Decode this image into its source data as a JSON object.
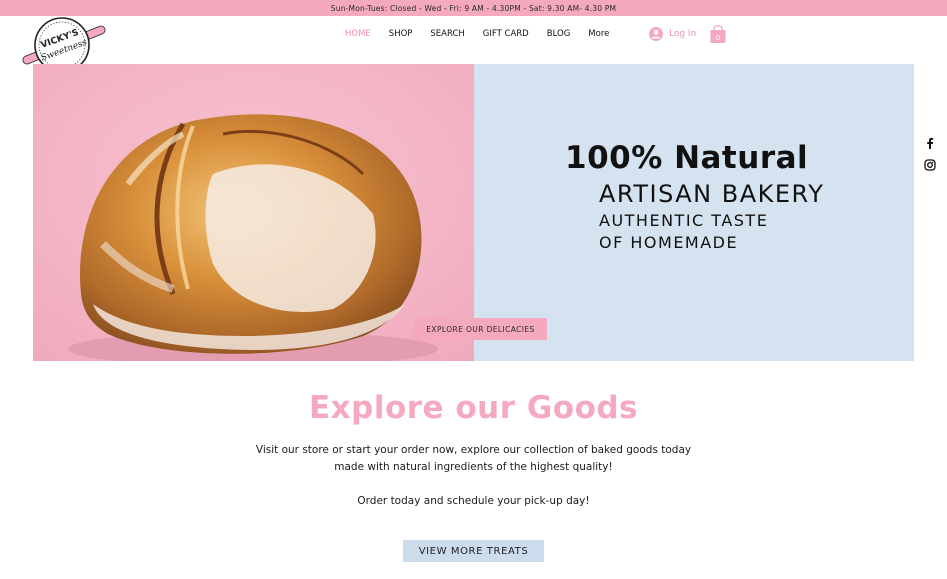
{
  "announcement": "Sun-Mon-Tues: Closed - Wed - Fri: 9 AM - 4.30PM - Sat: 9.30  AM- 4.30 PM",
  "logo": {
    "line1": "VICKY'S",
    "line2": "Sweetness"
  },
  "nav": [
    {
      "label": "HOME",
      "active": true
    },
    {
      "label": "SHOP",
      "active": false
    },
    {
      "label": "SEARCH",
      "active": false
    },
    {
      "label": "GIFT CARD",
      "active": false
    },
    {
      "label": "BLOG",
      "active": false
    },
    {
      "label": "More",
      "active": false
    }
  ],
  "login": {
    "label": "Log In"
  },
  "cart": {
    "count": "0"
  },
  "hero": {
    "headline": "100% Natural",
    "subheadline": "ARTISAN BAKERY",
    "tagline_line1": "AUTHENTIC TASTE",
    "tagline_line2": "OF HOMEMADE",
    "button": "EXPLORE OUR DELICACIES",
    "image": "sourdough-bread-loaf"
  },
  "social": [
    "facebook-icon",
    "instagram-icon"
  ],
  "section": {
    "title": "Explore our Goods",
    "body_line1": "Visit our store or start your order now, explore our collection of baked goods today",
    "body_line2": "made with natural ingredients of the highest quality!",
    "body_line3": "Order today and schedule your pick-up day!",
    "button": "VIEW MORE TREATS"
  },
  "colors": {
    "brand_pink": "#f4a9bf",
    "panel_blue": "#d5e3f0",
    "button_blue": "#cddcec"
  }
}
